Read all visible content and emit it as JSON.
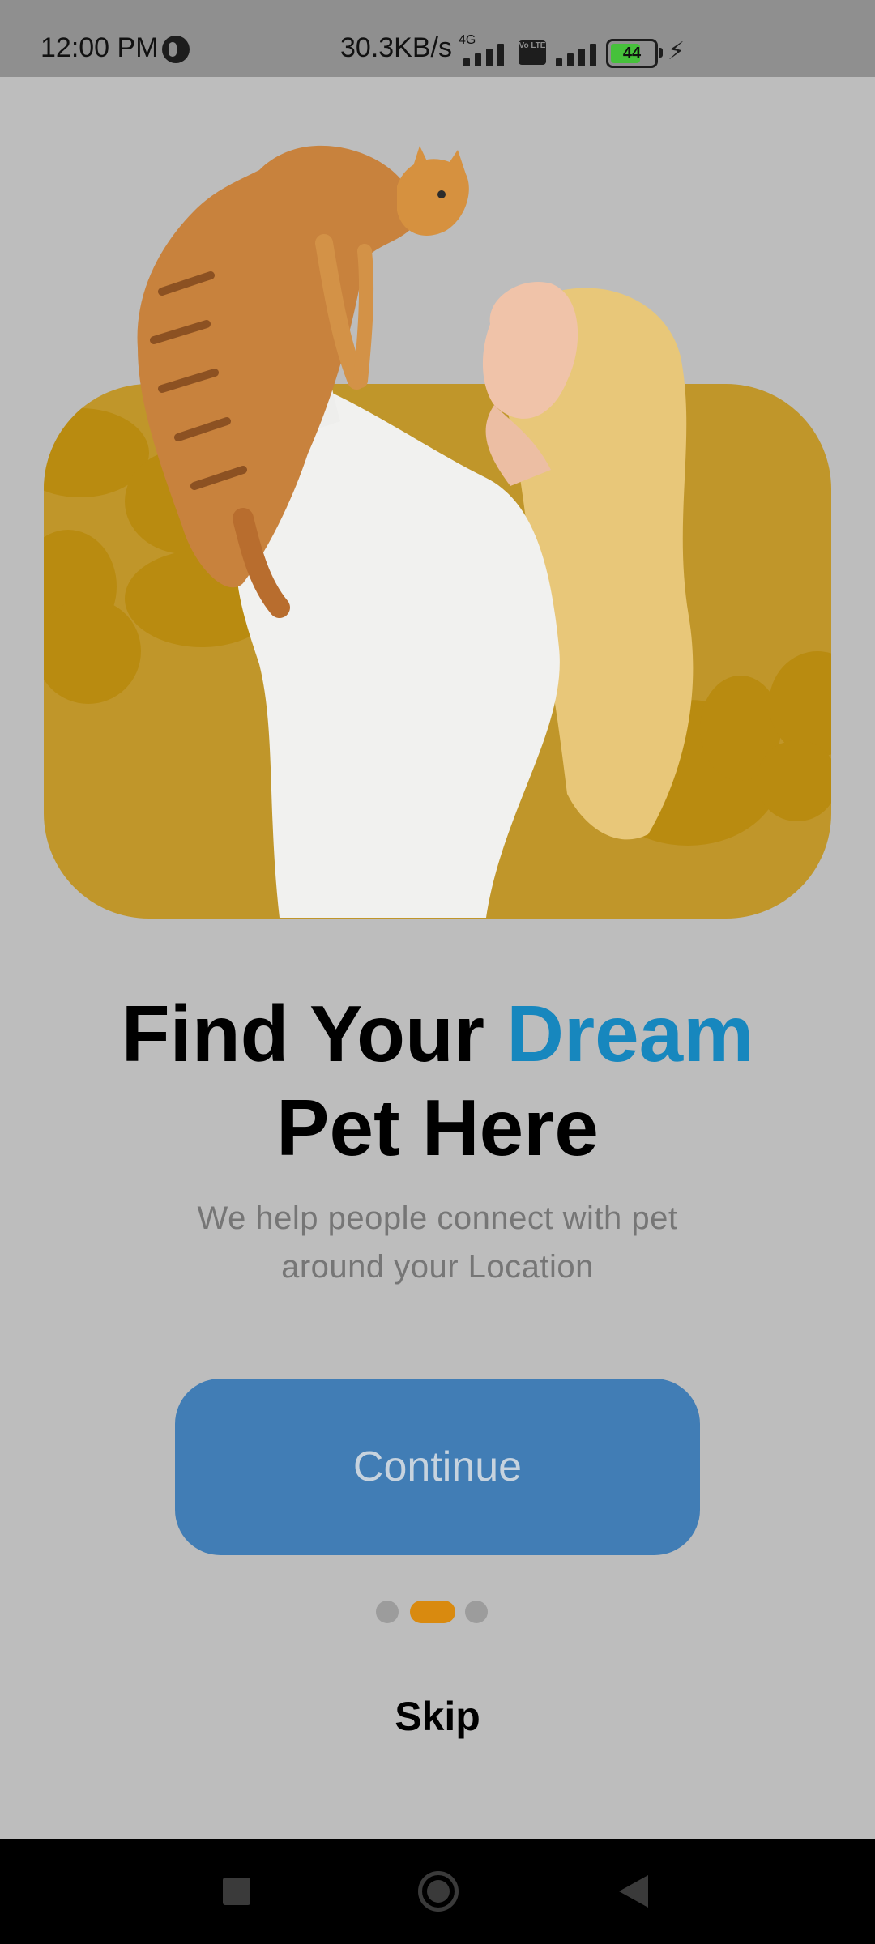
{
  "status_bar": {
    "time": "12:00 PM",
    "network_speed": "30.3KB/s",
    "network_type": "4G",
    "volte": "Vo LTE",
    "battery_level": "44",
    "icons": [
      "dnd-icon",
      "signal-icon",
      "volte-icon",
      "battery-icon",
      "charging-icon"
    ]
  },
  "hero": {
    "image_alt": "woman holding orange cat",
    "colors": {
      "card": "#c0962a",
      "paw": "#b98b10"
    }
  },
  "headline": {
    "part1": "Find Your ",
    "accent": "Dream",
    "line2": "Pet Here",
    "accent_color": "#1787be"
  },
  "subtitle": {
    "line1": "We help people connect with pet",
    "line2": "around your Location"
  },
  "continue_button": {
    "label": "Continue",
    "color": "#417db5"
  },
  "pager": {
    "total": 3,
    "active_index": 1,
    "active_color": "#d98a0f",
    "inactive_color": "#9c9c9c"
  },
  "skip": {
    "label": "Skip"
  },
  "nav_bar": {
    "icons": [
      "recents-square-icon",
      "home-circle-icon",
      "back-triangle-icon"
    ]
  }
}
